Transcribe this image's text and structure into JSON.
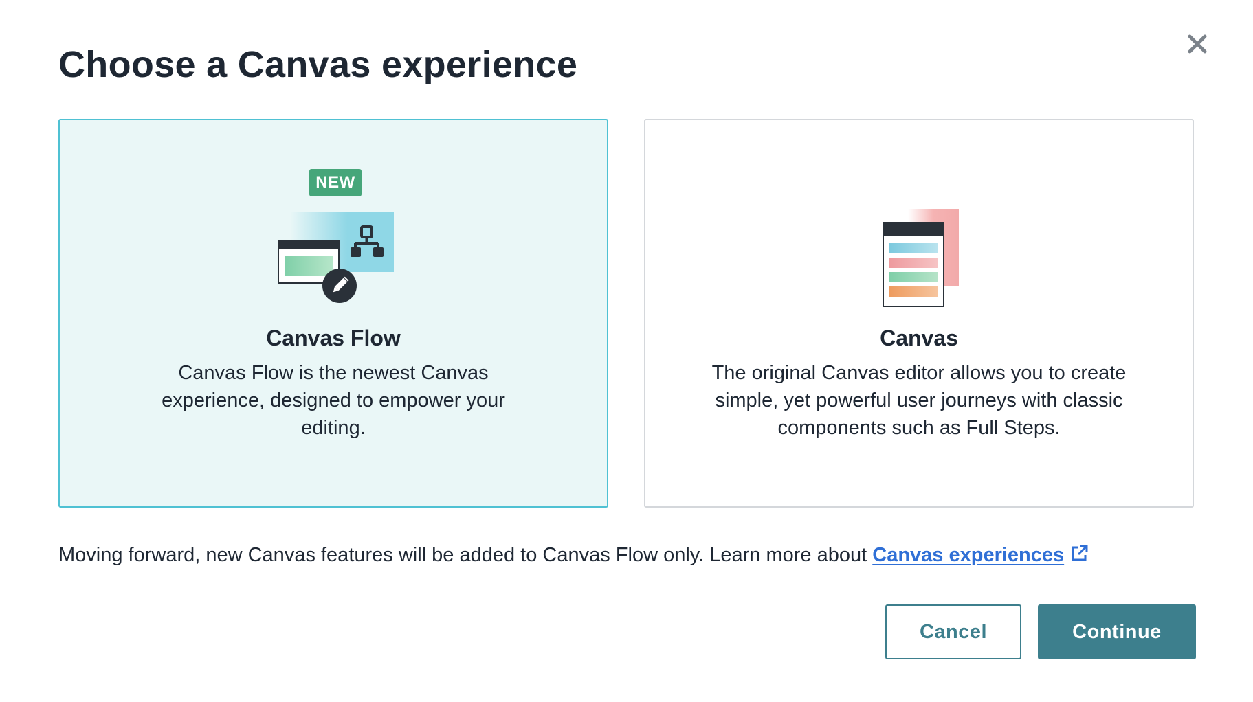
{
  "dialog": {
    "title": "Choose a Canvas experience",
    "close_icon": "close-icon"
  },
  "options": [
    {
      "badge": "NEW",
      "title": "Canvas Flow",
      "description": "Canvas Flow is the newest Canvas experience, designed to empower your editing.",
      "selected": true,
      "icon": "canvas-flow-illustration"
    },
    {
      "title": "Canvas",
      "description": "The original Canvas editor allows you to create simple, yet powerful user journeys with classic components such as Full Steps.",
      "selected": false,
      "icon": "canvas-illustration"
    }
  ],
  "note": {
    "text": "Moving forward, new Canvas features will be added to Canvas Flow only. Learn more about ",
    "link_label": "Canvas experiences",
    "link_icon": "external-link-icon"
  },
  "footer": {
    "cancel_label": "Cancel",
    "continue_label": "Continue"
  },
  "colors": {
    "accent": "#3d7f8d",
    "selected_bg": "#eaf7f7",
    "selected_border": "#4fc1d3",
    "badge": "#46a67a",
    "link": "#2f6fd6"
  }
}
